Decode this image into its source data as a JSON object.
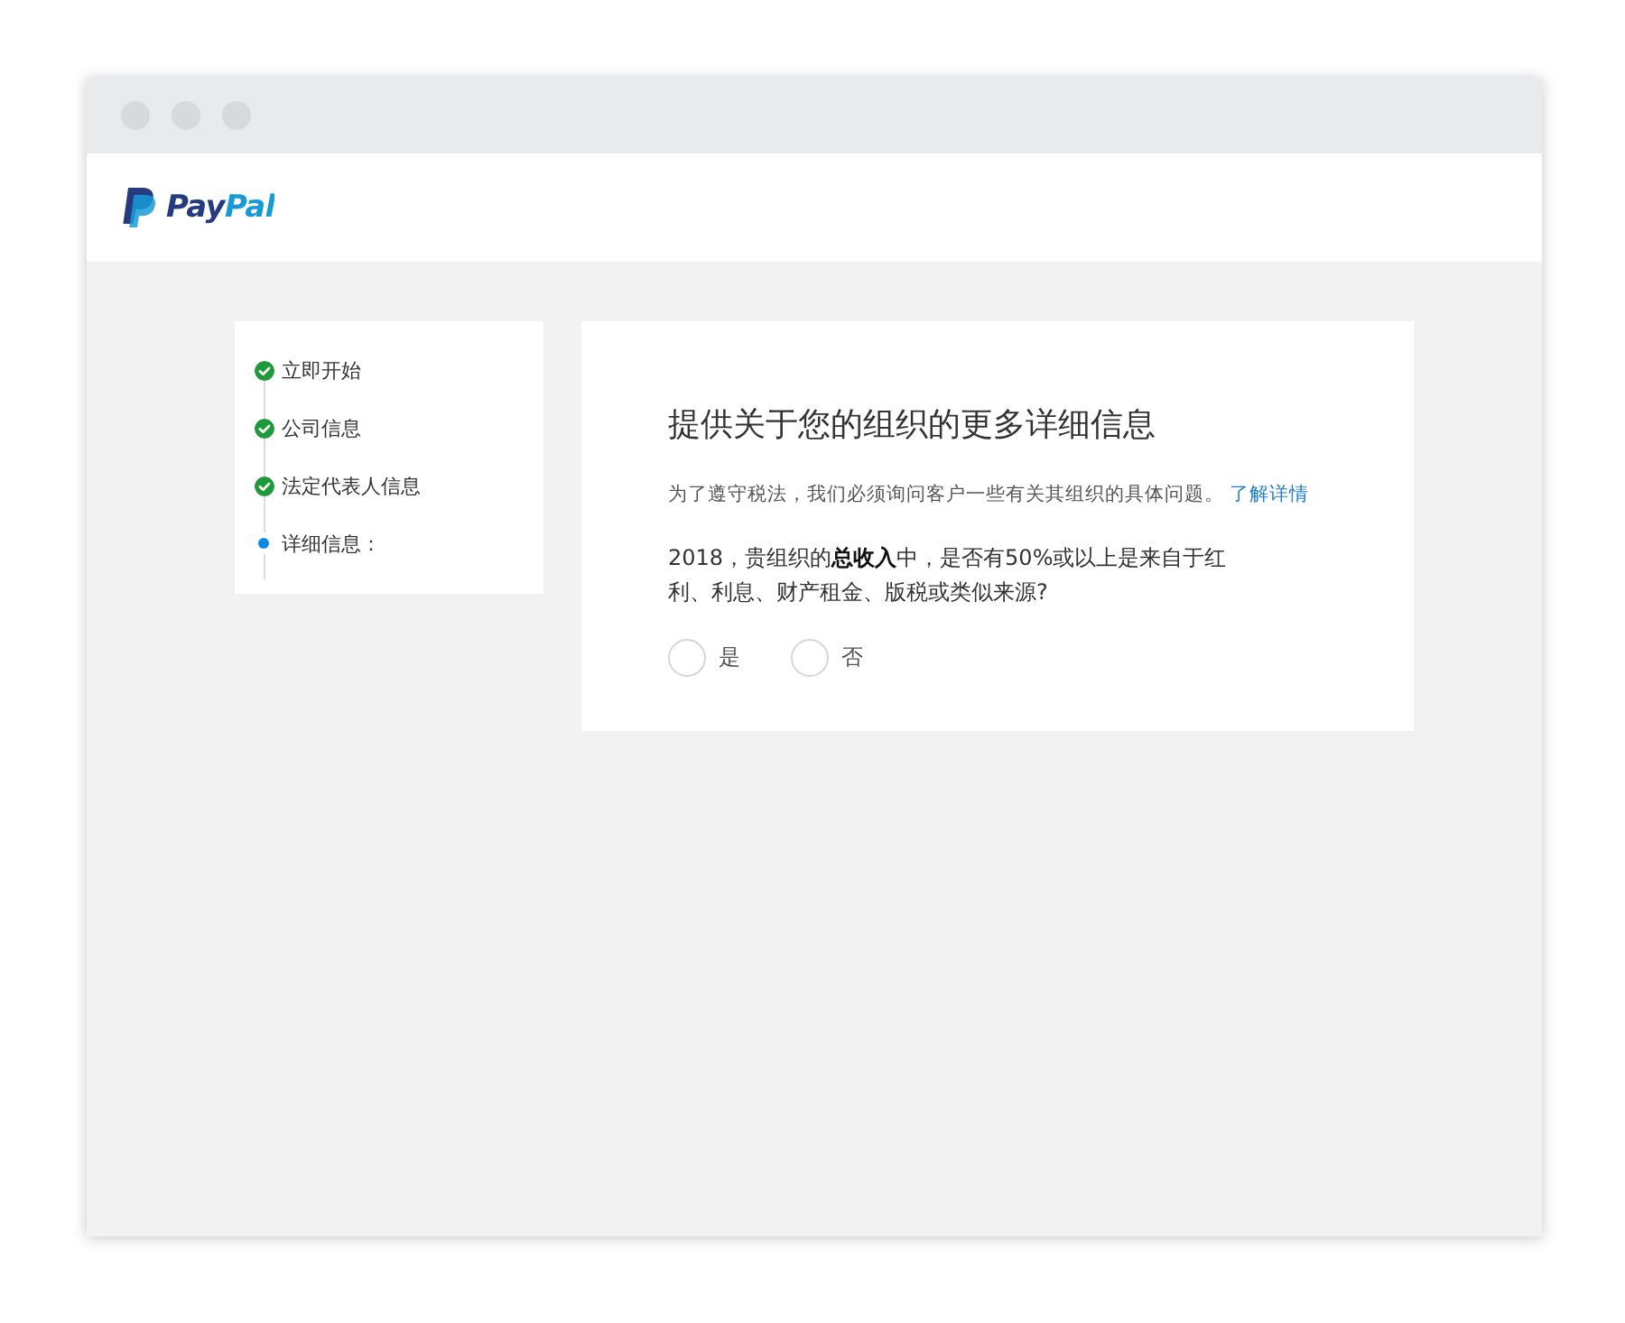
{
  "header": {
    "logo_text": "PayPal"
  },
  "steps": [
    {
      "label": "立即开始",
      "kind": "complete"
    },
    {
      "label": "公司信息",
      "kind": "complete"
    },
    {
      "label": "法定代表人信息",
      "kind": "complete"
    },
    {
      "label": "详细信息：",
      "kind": "current"
    }
  ],
  "form": {
    "title": "提供关于您的组织的更多详细信息",
    "intro": "为了遵守税法，我们必须询问客户一些有关其组织的具体问题。",
    "learn_more_link": "了解详情",
    "question": "2018，贵组织的**总收入**中，是否有50%或以上是来自于红利、利息、财产租金、版税或类似来源?",
    "options": [
      {
        "label": "是",
        "selected": false
      },
      {
        "label": "否",
        "selected": false
      }
    ]
  }
}
